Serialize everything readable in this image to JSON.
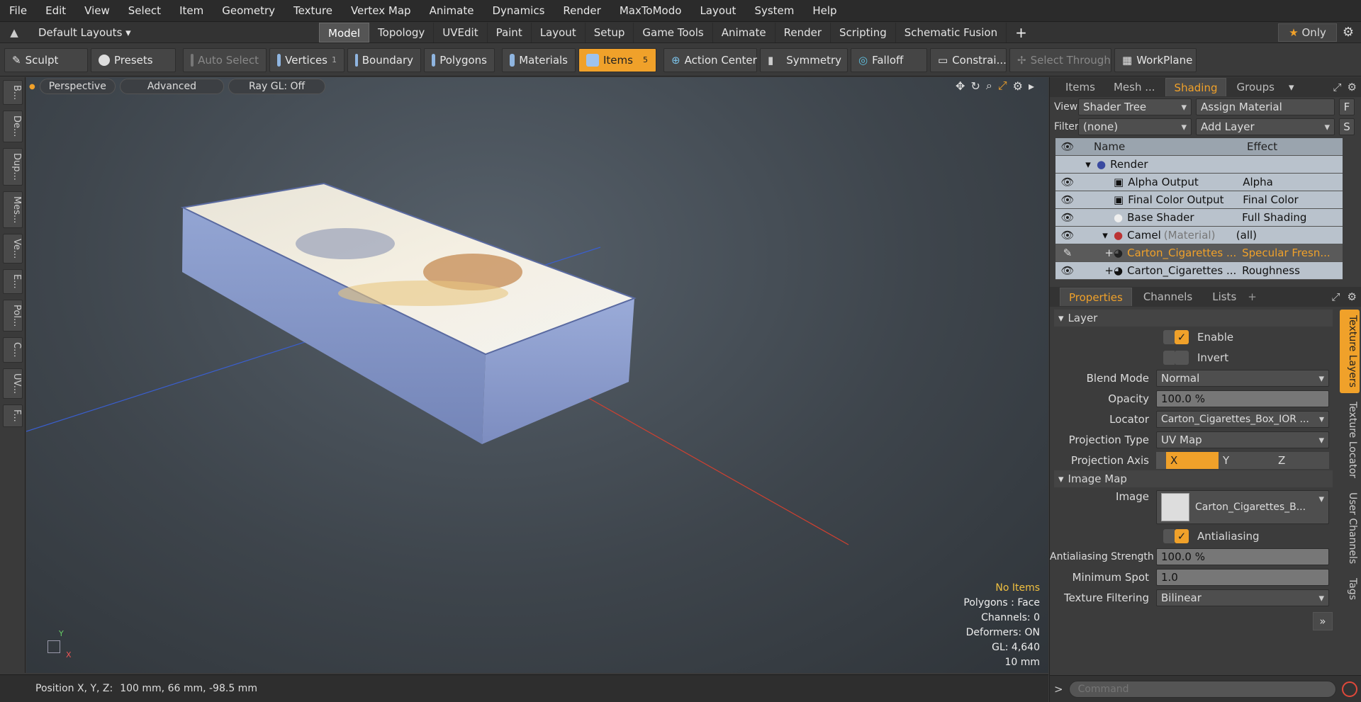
{
  "menubar": [
    "File",
    "Edit",
    "View",
    "Select",
    "Item",
    "Geometry",
    "Texture",
    "Vertex Map",
    "Animate",
    "Dynamics",
    "Render",
    "MaxToModo",
    "Layout",
    "System",
    "Help"
  ],
  "layoutbar": {
    "layout_label": "Default Layouts",
    "tabs": [
      "Model",
      "Topology",
      "UVEdit",
      "Paint",
      "Layout",
      "Setup",
      "Game Tools",
      "Animate",
      "Render",
      "Scripting",
      "Schematic Fusion"
    ],
    "active_tab": "Model",
    "add_label": "+",
    "only_label": "Only"
  },
  "toolbar": {
    "sculpt": "Sculpt",
    "presets": "Presets",
    "auto_select": "Auto Select",
    "vertices": "Vertices",
    "vertices_count": "1",
    "boundary": "Boundary",
    "polygons": "Polygons",
    "materials": "Materials",
    "items": "Items",
    "items_count": "5",
    "action_center": "Action Center",
    "symmetry": "Symmetry",
    "falloff": "Falloff",
    "constraints": "Constrai...",
    "select_through": "Select Through",
    "workplane": "WorkPlane"
  },
  "leftstrip": [
    "B...",
    "De...",
    "Dup...",
    "Mes...",
    "Ve...",
    "E...",
    "Pol...",
    "C...",
    "UV...",
    "F..."
  ],
  "viewport": {
    "perspective": "Perspective",
    "advanced": "Advanced",
    "raygl": "Ray GL: Off",
    "info": {
      "no_items": "No Items",
      "polygons": "Polygons : Face",
      "channels": "Channels: 0",
      "deformers": "Deformers: ON",
      "gl": "GL: 4,640",
      "scale": "10 mm"
    },
    "axis_x": "X",
    "axis_y": "Y"
  },
  "statusbar": {
    "position_label": "Position X, Y, Z:",
    "position_value": "100 mm, 66 mm, -98.5 mm"
  },
  "shading": {
    "tabs": [
      "Items",
      "Mesh ...",
      "Shading",
      "Groups"
    ],
    "active_tab": "Shading",
    "view_label": "View",
    "view_value": "Shader Tree",
    "assign_material": "Assign Material",
    "f_btn": "F",
    "filter_label": "Filter",
    "filter_value": "(none)",
    "add_layer": "Add Layer",
    "s_btn": "S",
    "col_name": "Name",
    "col_effect": "Effect",
    "rows": [
      {
        "name": "Render",
        "effect": "",
        "sub": ""
      },
      {
        "name": "Alpha Output",
        "effect": "Alpha",
        "sub": ""
      },
      {
        "name": "Final Color Output",
        "effect": "Final Color",
        "sub": ""
      },
      {
        "name": "Base Shader",
        "effect": "Full Shading",
        "sub": ""
      },
      {
        "name": "Camel",
        "effect": "(all)",
        "sub": "(Material)"
      },
      {
        "name": "Carton_Cigarettes ...",
        "effect": "Specular Fresn...",
        "sub": ""
      },
      {
        "name": "Carton_Cigarettes ...",
        "effect": "Roughness",
        "sub": ""
      }
    ]
  },
  "properties": {
    "tabs": [
      "Properties",
      "Channels",
      "Lists"
    ],
    "active_tab": "Properties",
    "layer_section": "Layer",
    "enable": "Enable",
    "invert": "Invert",
    "blend_mode_label": "Blend Mode",
    "blend_mode": "Normal",
    "opacity_label": "Opacity",
    "opacity": "100.0 %",
    "locator_label": "Locator",
    "locator": "Carton_Cigarettes_Box_IOR ...",
    "projection_type_label": "Projection Type",
    "projection_type": "UV Map",
    "projection_axis_label": "Projection Axis",
    "axis_x": "X",
    "axis_y": "Y",
    "axis_z": "Z",
    "image_map_section": "Image Map",
    "image_label": "Image",
    "image_value": "Carton_Cigarettes_B...",
    "antialiasing": "Antialiasing",
    "aa_strength_label": "Antialiasing Strength",
    "aa_strength": "100.0 %",
    "min_spot_label": "Minimum Spot",
    "min_spot": "1.0",
    "tex_filter_label": "Texture Filtering",
    "tex_filter": "Bilinear",
    "side_tabs": [
      "Texture Layers",
      "Texture Locator",
      "User Channels",
      "Tags"
    ]
  },
  "command": {
    "placeholder": "Command",
    "prompt": ">"
  },
  "colors": {
    "accent": "#f0a12a",
    "box_side": "#8f9fc9",
    "viewport_bg": "#3e454c"
  }
}
